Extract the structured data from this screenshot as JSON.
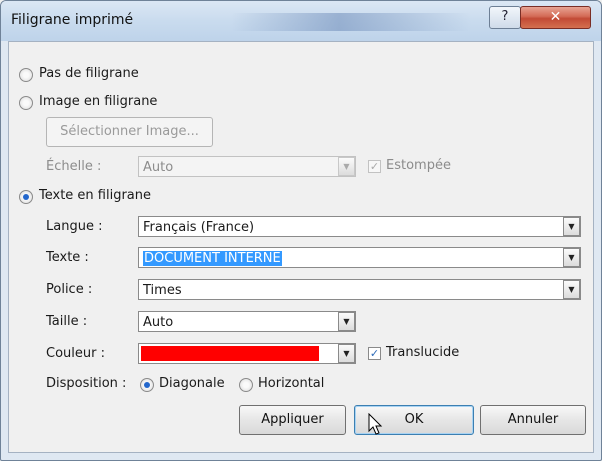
{
  "window": {
    "title": "Filigrane imprimé",
    "help_glyph": "?",
    "close_glyph": "✕"
  },
  "options": {
    "none": "Pas de filigrane",
    "image": "Image en filigrane",
    "select_image": "Sélectionner Image...",
    "scale_label": "Échelle :",
    "scale_value": "Auto",
    "washout": "Estompée",
    "text": "Texte en filigrane"
  },
  "text_fields": {
    "language_label": "Langue :",
    "language_value": "Français (France)",
    "text_label": "Texte :",
    "text_value": "DOCUMENT INTERNE",
    "font_label": "Police :",
    "font_value": "Times",
    "size_label": "Taille :",
    "size_value": "Auto",
    "color_label": "Couleur :",
    "color_value": "#ff0000",
    "translucent": "Translucide",
    "layout_label": "Disposition :",
    "diagonal": "Diagonale",
    "horizontal": "Horizontal"
  },
  "buttons": {
    "apply": "Appliquer",
    "ok": "OK",
    "cancel": "Annuler"
  },
  "icons": {
    "dropdown": "▼",
    "check": "✓"
  }
}
